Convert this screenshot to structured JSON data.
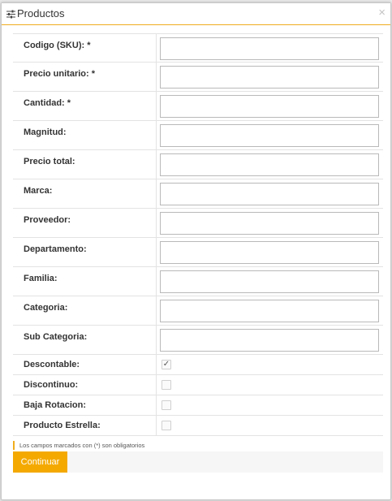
{
  "dialog": {
    "title": "Productos",
    "title_icon": "sliders-icon",
    "close_label": "×"
  },
  "fields": [
    {
      "label": "Codigo (SKU): *",
      "value": ""
    },
    {
      "label": "Precio unitario: *",
      "value": ""
    },
    {
      "label": "Cantidad: *",
      "value": ""
    },
    {
      "label": "Magnitud:",
      "value": ""
    },
    {
      "label": "Precio total:",
      "value": ""
    },
    {
      "label": "Marca:",
      "value": ""
    },
    {
      "label": "Proveedor:",
      "value": ""
    },
    {
      "label": "Departamento:",
      "value": ""
    },
    {
      "label": "Familia:",
      "value": ""
    },
    {
      "label": "Categoria:",
      "value": ""
    },
    {
      "label": "Sub Categoria:",
      "value": ""
    }
  ],
  "checkboxes": [
    {
      "label": "Descontable:",
      "checked": true,
      "mark": "✓"
    },
    {
      "label": "Discontinuo:",
      "checked": false,
      "mark": ""
    },
    {
      "label": "Baja Rotacion:",
      "checked": false,
      "mark": ""
    },
    {
      "label": "Producto Estrella:",
      "checked": false,
      "mark": ""
    }
  ],
  "note": "Los campos marcados con (*) son obligatorios",
  "continue_label": "Continuar",
  "colors": {
    "accent": "#f0ad1e",
    "button": "#f4a900"
  }
}
